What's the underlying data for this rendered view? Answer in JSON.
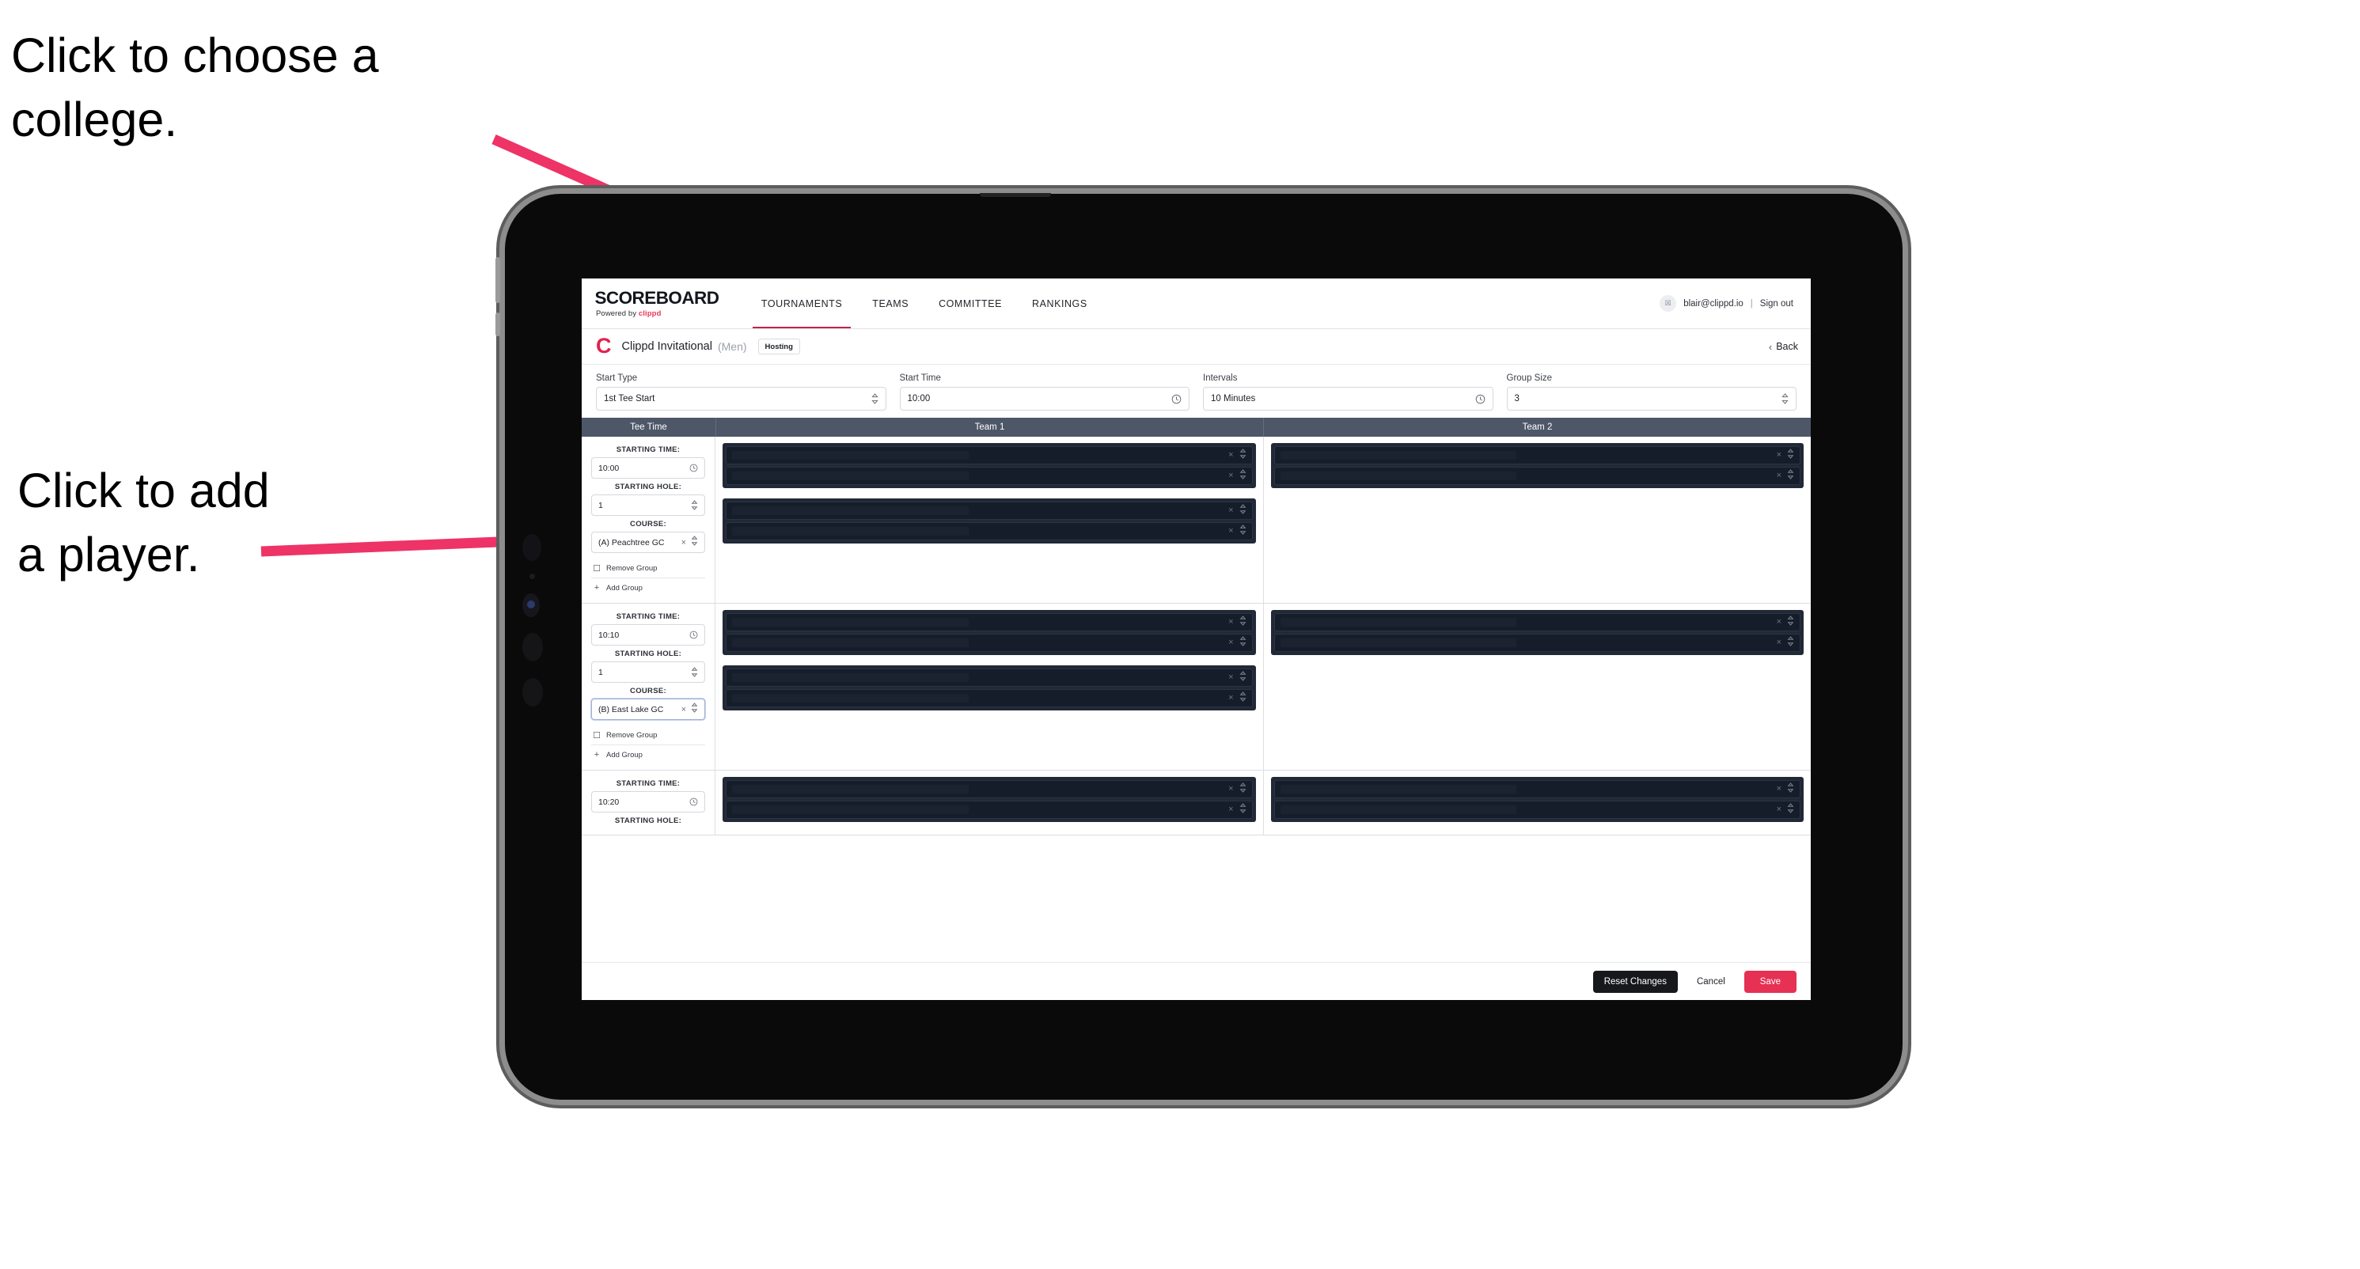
{
  "annotations": {
    "college": "Click to choose a\ncollege.",
    "player": "Click to add\na player."
  },
  "colors": {
    "accent": "#e63054",
    "brand_red": "#e0224c",
    "table_header": "#4e5768",
    "panel_dark": "#212936",
    "slot_dark": "#161d2a"
  },
  "topnav": {
    "brand_main": "SCOREBOARD",
    "brand_sub_prefix": "Powered by ",
    "brand_sub_brand": "clippd",
    "items": [
      {
        "label": "TOURNAMENTS",
        "active": true
      },
      {
        "label": "TEAMS",
        "active": false
      },
      {
        "label": "COMMITTEE",
        "active": false
      },
      {
        "label": "RANKINGS",
        "active": false
      }
    ],
    "avatar_glyph": "☒",
    "user_email": "blair@clippd.io",
    "separator": "|",
    "sign_out": "Sign out"
  },
  "subheader": {
    "logo_letter": "C",
    "tournament_name": "Clippd Invitational",
    "gender": "(Men)",
    "badge": "Hosting",
    "back_chevron": "‹",
    "back_label": "Back"
  },
  "form": {
    "fields": [
      {
        "label": "Start Type",
        "value": "1st Tee Start",
        "icon": "stepper-icon"
      },
      {
        "label": "Start Time",
        "value": "10:00",
        "icon": "clock-icon"
      },
      {
        "label": "Intervals",
        "value": "10 Minutes",
        "icon": "clock-icon"
      },
      {
        "label": "Group Size",
        "value": "3",
        "icon": "stepper-icon"
      }
    ]
  },
  "table": {
    "headers": [
      "Tee Time",
      "Team 1",
      "Team 2"
    ],
    "labels": {
      "starting_time": "STARTING TIME:",
      "starting_hole": "STARTING HOLE:",
      "course": "COURSE:",
      "remove_group": "Remove Group",
      "add_group": "Add Group",
      "trash_icon": "☐",
      "plus_icon": "+",
      "clear_icon": "×"
    },
    "rows": [
      {
        "starting_time": "10:00",
        "starting_hole": "1",
        "course": "(A) Peachtree GC",
        "course_focused": false,
        "team1_groups": [
          2,
          2
        ],
        "team2_groups": [
          2
        ]
      },
      {
        "starting_time": "10:10",
        "starting_hole": "1",
        "course": "(B) East Lake GC",
        "course_focused": true,
        "team1_groups": [
          2,
          2
        ],
        "team2_groups": [
          2
        ]
      },
      {
        "starting_time": "10:20",
        "starting_hole": "",
        "course": "",
        "course_focused": false,
        "team1_groups": [
          2
        ],
        "team2_groups": [
          2
        ]
      }
    ]
  },
  "footer": {
    "reset_label": "Reset Changes",
    "cancel_label": "Cancel",
    "save_label": "Save"
  }
}
